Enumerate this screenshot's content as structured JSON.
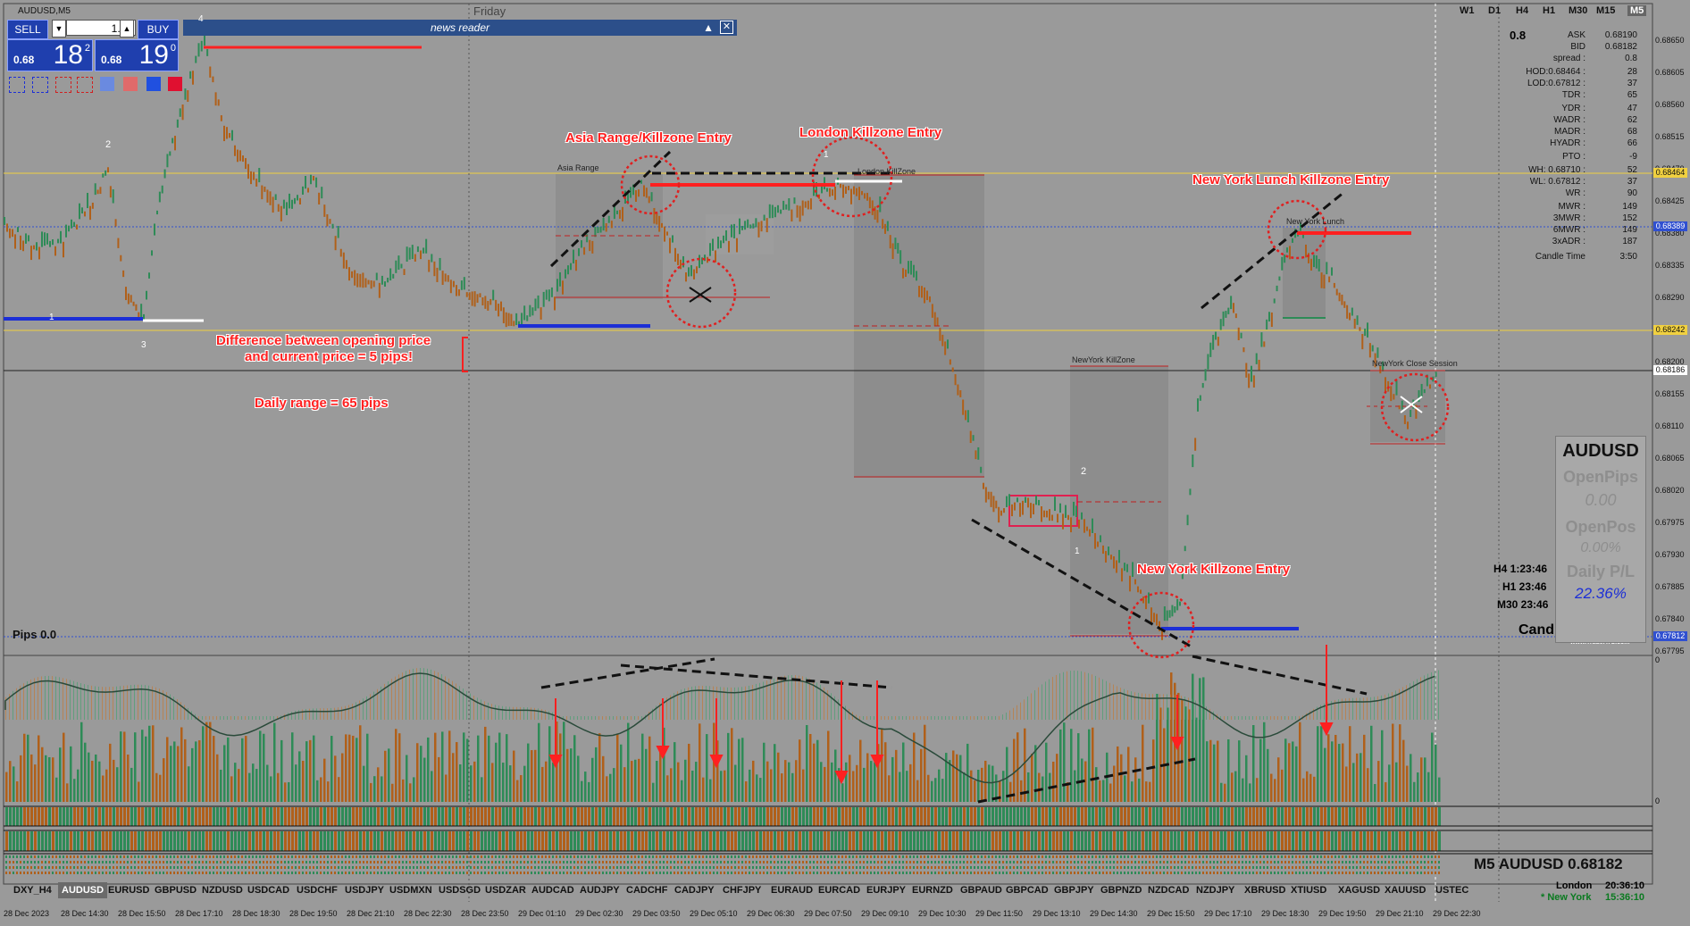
{
  "window": {
    "symbol_title": "AUDUSD,M5",
    "day_label": "Friday"
  },
  "trade_panel": {
    "sell_label": "SELL",
    "buy_label": "BUY",
    "lot": "1.00",
    "bid_small": "0.68",
    "bid_big": "18",
    "bid_sup": "2",
    "ask_small": "0.68",
    "ask_big": "19",
    "ask_sup": "0"
  },
  "news_reader": {
    "title": "news reader"
  },
  "timeframes": [
    "W1",
    "D1",
    "H4",
    "H1",
    "M30",
    "M15",
    "M5"
  ],
  "info_panel": {
    "spread_pts": "0.8",
    "rows": [
      {
        "k": "ASK",
        "v": "0.68190"
      },
      {
        "k": "BID",
        "v": "0.68182"
      },
      {
        "k": "spread :",
        "v": "0.8"
      },
      {
        "k": "HOD:0.68464 :",
        "v": "28"
      },
      {
        "k": "LOD:0.67812 :",
        "v": "37"
      },
      {
        "k": "TDR :",
        "v": "65"
      },
      {
        "k": "YDR :",
        "v": "47"
      },
      {
        "k": "WADR :",
        "v": "62"
      },
      {
        "k": "MADR :",
        "v": "68"
      },
      {
        "k": "HYADR :",
        "v": "66"
      },
      {
        "k": "PTO :",
        "v": "-9"
      },
      {
        "k": "WH: 0.68710 :",
        "v": "52"
      },
      {
        "k": "WL: 0.67812 :",
        "v": "37"
      },
      {
        "k": "WR :",
        "v": "90"
      },
      {
        "k": "MWR :",
        "v": "149"
      },
      {
        "k": "3MWR :",
        "v": "152"
      },
      {
        "k": "6MWR :",
        "v": "149"
      },
      {
        "k": "3xADR :",
        "v": "187"
      },
      {
        "k": "Candle Time",
        "v": "3:50"
      }
    ]
  },
  "price_axis": [
    "0.68650",
    "0.68605",
    "0.68560",
    "0.68515",
    "0.68470",
    "0.68425",
    "0.68380",
    "0.68335",
    "0.68290",
    "0.68245",
    "0.68200",
    "0.68155",
    "0.68110",
    "0.68065",
    "0.68020",
    "0.67975",
    "0.67930",
    "0.67885",
    "0.67840",
    "0.67795"
  ],
  "price_tags": [
    {
      "v": "0.68464",
      "c": "#f0d040"
    },
    {
      "v": "0.68389",
      "c": "#3050d0"
    },
    {
      "v": "0.68242",
      "c": "#f0d040"
    },
    {
      "v": "0.68186",
      "c": "#ffffff"
    },
    {
      "v": "0.67812",
      "c": "#3050d0"
    }
  ],
  "annotations": {
    "asia": "Asia Range/Killzone Entry",
    "london": "London Killzone Entry",
    "nylunch": "New York Lunch Killzone Entry",
    "ny": "New York Killzone Entry",
    "diff1": "Difference between opening price",
    "diff2": "and current price = 5 pips!",
    "range": "Daily range = 65 pips"
  },
  "sessions": {
    "asia": "Asia Range",
    "london": "London KillZone",
    "nylunch": "New York Lunch",
    "nyk": "NewYork KillZone",
    "nyclose": "NewYork Close Session"
  },
  "numbers": {
    "n4": "4",
    "n2a": "2",
    "n1a": "1",
    "n3": "3",
    "n1b": "1",
    "n2b": "2",
    "n1c": "1"
  },
  "pips_label": "Pips 0.0",
  "tf_remaining": {
    "h4": "H4 1:23:46",
    "h1": "H1 23:46",
    "m30": "M30 23:46"
  },
  "candle_time": "Candle time:  3:46",
  "watermark": "www.TradeATS.com",
  "open_box": {
    "symbol": "AUDUSD",
    "open_pips_label": "OpenPips",
    "open_pips": "0.00",
    "open_pos_label": "OpenPos",
    "open_pos": "0.00%",
    "daily_pl_label": "Daily P/L",
    "daily_pl": "22.36%"
  },
  "indicator_axis": {
    "top": "0",
    "bottom": "0"
  },
  "bottom_title": "M5 AUDUSD 0.68182",
  "symbol_tabs": [
    "DXY_H4",
    "AUDUSD",
    "EURUSD",
    "GBPUSD",
    "NZDUSD",
    "USDCAD",
    "USDCHF",
    "USDJPY",
    "USDMXN",
    "USDSGD",
    "USDZAR",
    "AUDCAD",
    "AUDJPY",
    "CADCHF",
    "CADJPY",
    "CHFJPY",
    "EURAUD",
    "EURCAD",
    "EURJPY",
    "EURNZD",
    "GBPAUD",
    "GBPCAD",
    "GBPJPY",
    "GBPNZD",
    "NZDCAD",
    "NZDJPY",
    "XBRUSD",
    "XTIUSD",
    "XAGUSD",
    "XAUUSD",
    "USTEC"
  ],
  "active_tab": "AUDUSD",
  "sessions_clock": {
    "london": "London",
    "london_time": "20:36:10",
    "ny": "* New York",
    "ny_time": "15:36:10"
  },
  "time_axis": [
    "28 Dec 2023",
    "28 Dec 14:30",
    "28 Dec 15:50",
    "28 Dec 17:10",
    "28 Dec 18:30",
    "28 Dec 19:50",
    "28 Dec 21:10",
    "28 Dec 22:30",
    "28 Dec 23:50",
    "29 Dec 01:10",
    "29 Dec 02:30",
    "29 Dec 03:50",
    "29 Dec 05:10",
    "29 Dec 06:30",
    "29 Dec 07:50",
    "29 Dec 09:10",
    "29 Dec 10:30",
    "29 Dec 11:50",
    "29 Dec 13:10",
    "29 Dec 14:30",
    "29 Dec 15:50",
    "29 Dec 17:10",
    "29 Dec 18:30",
    "29 Dec 19:50",
    "29 Dec 21:10",
    "29 Dec 22:30"
  ],
  "colors": {
    "bg": "#9a9a9a",
    "bull": "#2e8b57",
    "bear": "#b0601a",
    "red": "#ff2020",
    "blue": "#1c2fd6",
    "yellow": "#f0d040"
  }
}
